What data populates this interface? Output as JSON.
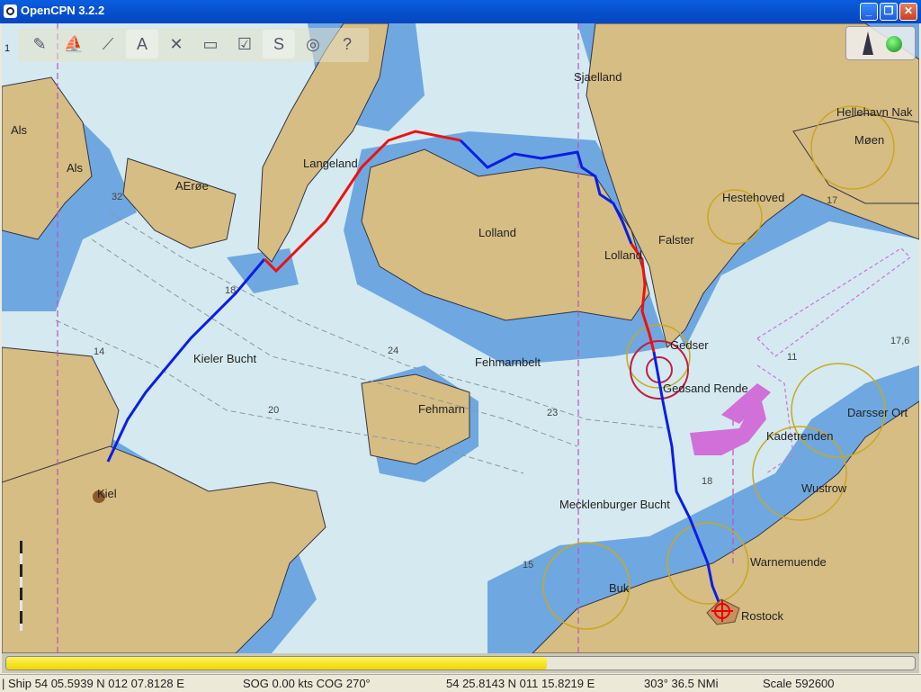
{
  "window": {
    "title": "OpenCPN 3.2.2",
    "minimize": "_",
    "restore": "❐",
    "close": "✕"
  },
  "toolbar": {
    "tools": [
      {
        "icon": "route-icon",
        "glyph": "✎"
      },
      {
        "icon": "boat-icon",
        "glyph": "⛵"
      },
      {
        "icon": "measure-icon",
        "glyph": "⟋"
      },
      {
        "icon": "text-icon",
        "glyph": "A"
      },
      {
        "icon": "tides-icon",
        "glyph": "✕"
      },
      {
        "icon": "chart-icon",
        "glyph": "▭"
      },
      {
        "icon": "settings-icon",
        "glyph": "☑"
      },
      {
        "icon": "track-icon",
        "glyph": "S"
      },
      {
        "icon": "globe-icon",
        "glyph": "◎"
      },
      {
        "icon": "help-icon",
        "glyph": "?"
      }
    ]
  },
  "page_marker": "1",
  "map_labels": {
    "als1": "Als",
    "als2": "Als",
    "aeroe": "AErøe",
    "langeland": "Langeland",
    "sjaelland": "Sjaelland",
    "hellehavn": "Hellehavn Nak",
    "moen": "Møen",
    "hesterhoved": "Hestehoved",
    "lolland1": "Lolland",
    "lolland2": "Lolland",
    "falster": "Falster",
    "gedser": "Gedser",
    "gedsand": "Gedsand Rende",
    "fehmarnbelt": "Fehmarnbelt",
    "kieler_bucht": "Kieler Bucht",
    "fehmarn": "Fehmarn",
    "kiel": "Kiel",
    "darsser": "Darsser Ort",
    "kadetrenden": "Kadetrenden",
    "wustrow": "Wustrow",
    "mecklenburger": "Mecklenburger Bucht",
    "warnemuende": "Warnemuende",
    "buk": "Buk",
    "rostock": "Rostock"
  },
  "depths": {
    "d32": "32",
    "d18a": "18",
    "d14": "14",
    "d20": "20",
    "d24": "24",
    "d23": "23",
    "d18b": "18",
    "d15": "15",
    "d11": "11",
    "d17a": "17",
    "d176": "17,6"
  },
  "progress": {
    "fraction": 0.595
  },
  "status": {
    "ship": "| Ship 54 05.5939 N   012 07.8128 E",
    "sog_cog": "SOG 0.00 kts   COG 270°",
    "cursor": "54 25.8143 N   011 15.8219 E",
    "bearing": "303°   36.5 NMi",
    "scale": "Scale 592600"
  },
  "colors": {
    "land": "#d6bd84",
    "shallow": "#6fa8e0",
    "sea": "#d4eaf0",
    "track_blue": "#0a1ee6",
    "track_red": "#ee1111",
    "boundary": "#c050c0"
  }
}
